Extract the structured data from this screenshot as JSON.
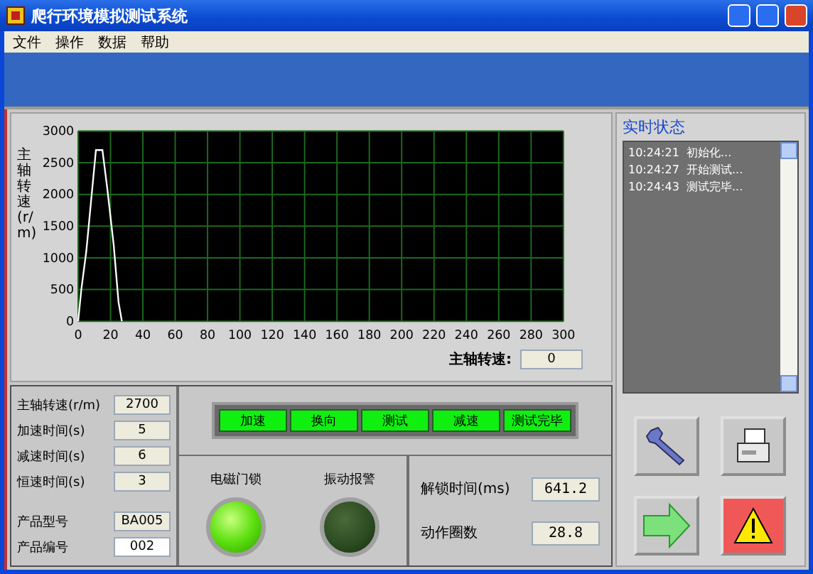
{
  "window": {
    "title": "爬行环境模拟测试系统"
  },
  "menu": [
    {
      "label": "文件"
    },
    {
      "label": "操作"
    },
    {
      "label": "数据"
    },
    {
      "label": "帮助"
    }
  ],
  "chart": {
    "readout_label": "主轴转速:",
    "readout_value": "0",
    "chart_data": {
      "type": "line",
      "grid": true,
      "ylabel": "主轴转速(r/m)",
      "xlim": [
        0,
        300
      ],
      "ylim": [
        0,
        3000
      ],
      "xticks": [
        0,
        20,
        40,
        60,
        80,
        100,
        120,
        140,
        160,
        180,
        200,
        220,
        240,
        260,
        280,
        300
      ],
      "yticks": [
        0,
        500,
        1000,
        1500,
        2000,
        2500,
        3000
      ],
      "x": [
        0,
        2,
        5,
        8,
        11,
        15,
        18,
        22,
        25,
        27
      ],
      "series": [
        {
          "color": "#ffffff",
          "values": [
            0,
            500,
            1100,
            1900,
            2700,
            2700,
            2100,
            1200,
            300,
            0
          ]
        }
      ]
    }
  },
  "status": {
    "title": "实时状态",
    "lines": [
      "10:24:21  初始化...",
      "10:24:27  开始测试...",
      "10:24:43  测试完毕..."
    ]
  },
  "params": [
    {
      "label": "主轴转速(r/m)",
      "value": "2700",
      "kind": "display"
    },
    {
      "label": "加速时间(s)",
      "value": "5",
      "kind": "display"
    },
    {
      "label": "减速时间(s)",
      "value": "6",
      "kind": "display"
    },
    {
      "label": "恒速时间(s)",
      "value": "3",
      "kind": "display"
    },
    {
      "label": "产品型号",
      "value": "BA005",
      "kind": "display"
    },
    {
      "label": "产品编号",
      "value": "002",
      "kind": "input"
    }
  ],
  "steps": [
    {
      "label": "加速",
      "on": true
    },
    {
      "label": "换向",
      "on": true
    },
    {
      "label": "测试",
      "on": true
    },
    {
      "label": "减速",
      "on": true
    },
    {
      "label": "测试完毕",
      "on": true
    }
  ],
  "lamps": [
    {
      "label": "电磁门锁",
      "on": true
    },
    {
      "label": "振动报警",
      "on": false
    }
  ],
  "measures": [
    {
      "label": "解锁时间(ms)",
      "value": "641.2"
    },
    {
      "label": "动作圈数",
      "value": "28.8"
    }
  ]
}
